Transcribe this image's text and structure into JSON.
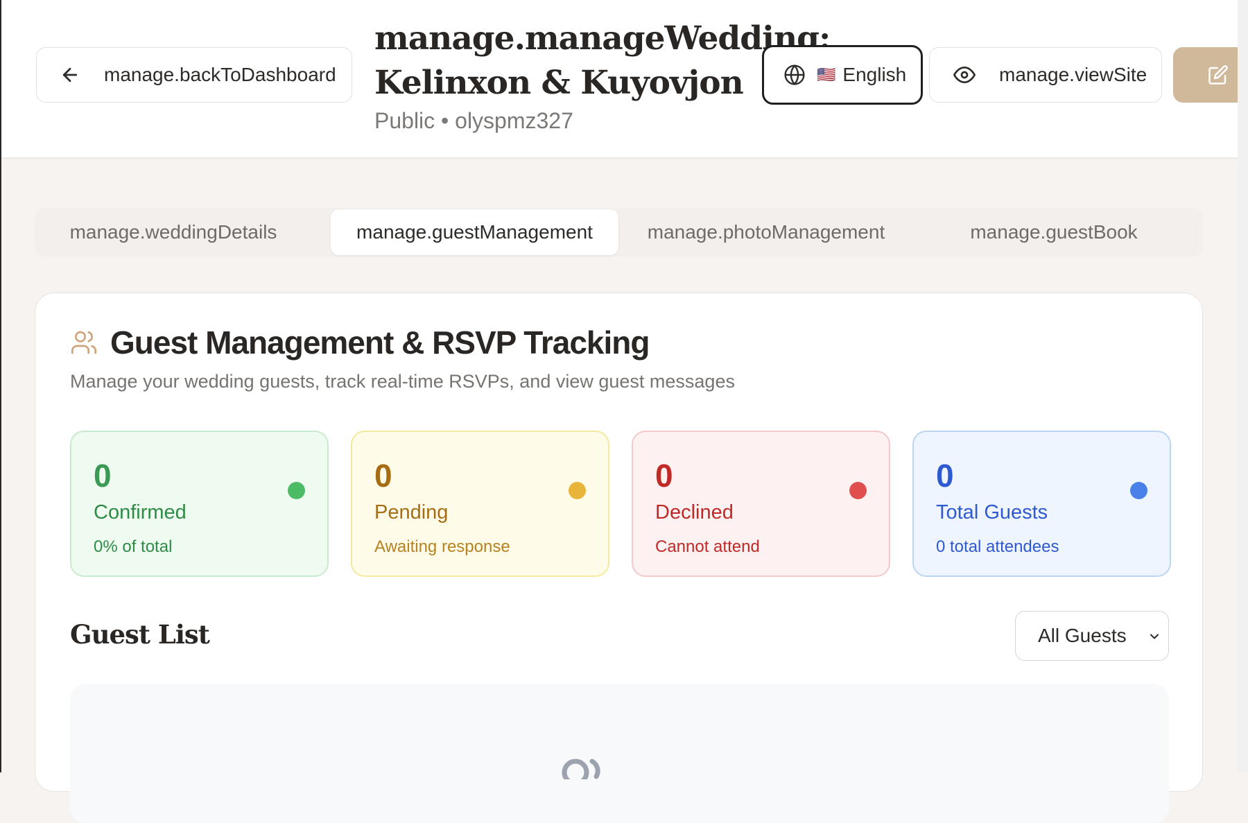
{
  "header": {
    "back_label": "manage.backToDashboard",
    "title_line1": "manage.manageWedding:",
    "title_line2": "Kelinxon & Kuyovjon",
    "subtitle": "Public • olyspmz327",
    "language_flag": "🇺🇸",
    "language_label": "English",
    "view_site_label": "manage.viewSite",
    "edit_icon": "edit-icon"
  },
  "tabs": [
    {
      "label": "manage.weddingDetails",
      "active": false
    },
    {
      "label": "manage.guestManagement",
      "active": true
    },
    {
      "label": "manage.photoManagement",
      "active": false
    },
    {
      "label": "manage.guestBook",
      "active": false
    }
  ],
  "guest_section": {
    "title": "Guest Management & RSVP Tracking",
    "description": "Manage your wedding guests, track real-time RSVPs, and view guest messages",
    "stats": [
      {
        "value": "0",
        "label": "Confirmed",
        "sub": "0% of total",
        "color": "#4cbb66"
      },
      {
        "value": "0",
        "label": "Pending",
        "sub": "Awaiting response",
        "color": "#e8b53a"
      },
      {
        "value": "0",
        "label": "Declined",
        "sub": "Cannot attend",
        "color": "#e04e4e"
      },
      {
        "value": "0",
        "label": "Total Guests",
        "sub": "0 total attendees",
        "color": "#4a80ea"
      }
    ],
    "guest_list_title": "Guest List",
    "filter_selected": "All Guests"
  },
  "colors": {
    "accent": "#cfb99a",
    "background": "#f7f3f1"
  }
}
